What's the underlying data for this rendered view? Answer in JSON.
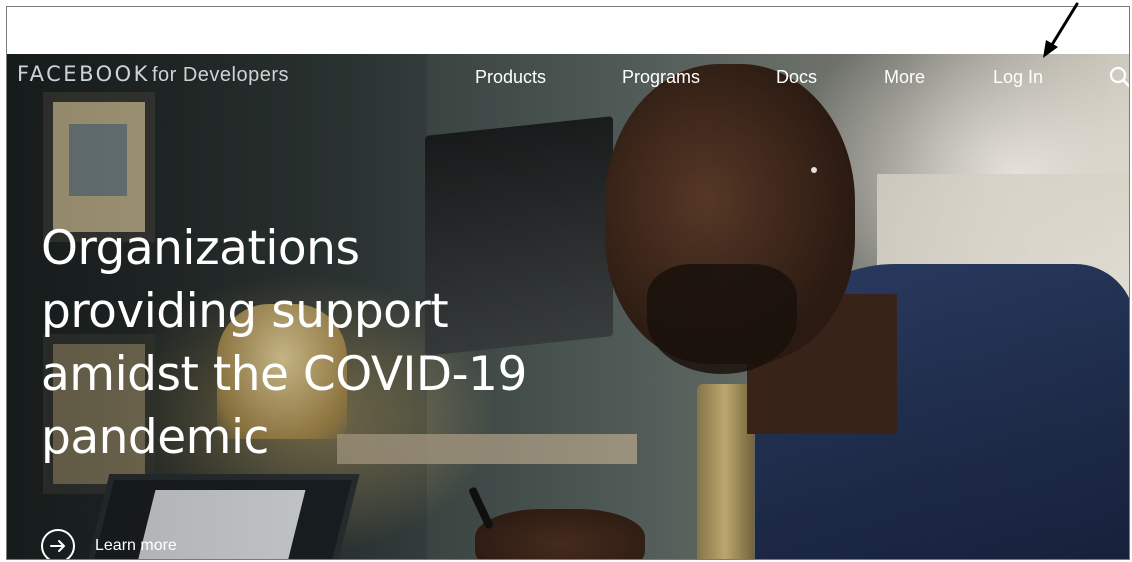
{
  "header": {
    "logo_brand": "FACEBOOK",
    "logo_suffix": "for Developers"
  },
  "nav": {
    "items": [
      {
        "label": "Products"
      },
      {
        "label": "Programs"
      },
      {
        "label": "Docs"
      },
      {
        "label": "More"
      },
      {
        "label": "Log In"
      }
    ],
    "search_icon": "search-icon"
  },
  "hero": {
    "headline_lines": [
      "Organizations",
      "providing support",
      "amidst the COVID-19",
      "pandemic"
    ],
    "cta_label": "Learn more",
    "cta_icon": "arrow-right-icon"
  },
  "annotation": {
    "icon": "pointer-arrow-icon",
    "color": "#000000"
  },
  "colors": {
    "nav_text": "#ffffff",
    "logo_text": "#cfd3d5",
    "frame_border": "#7a7a7a"
  }
}
